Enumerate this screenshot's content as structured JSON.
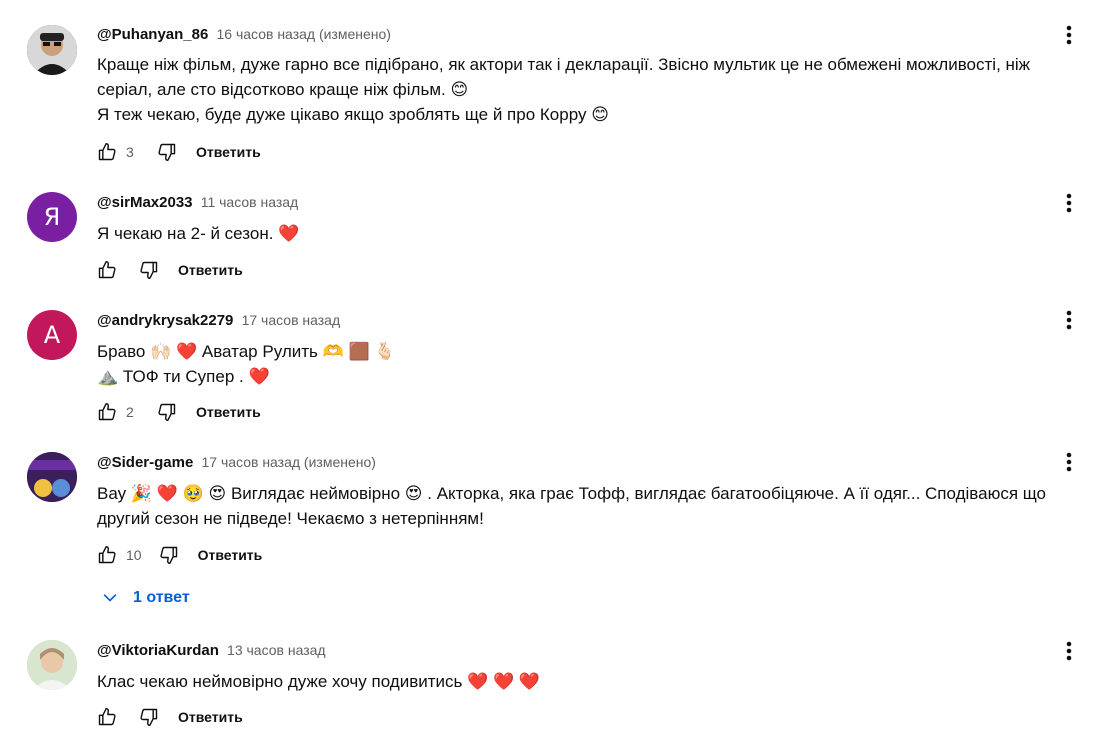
{
  "comments": [
    {
      "author": "@Puhanyan_86",
      "time": "16 часов назад (изменено)",
      "lines": [
        "Краще ніж фільм, дуже гарно все підібрано, як актори так і декларації. Звісно мультик це не обмежені можливості, ніж",
        "серіал, але сто відсотково краще ніж фільм. 😊",
        "Я теж чекаю, буде дуже цікаво якщо зроблять ще й про Корру 😊"
      ],
      "likes": "3",
      "reply_label": "Ответить",
      "avatar": {
        "type": "photo",
        "bg": "#2b2b2b"
      }
    },
    {
      "author": "@sirMax2033",
      "time": "11 часов назад",
      "lines": [
        "Я чекаю на 2- й сезон. ❤️"
      ],
      "likes": "",
      "reply_label": "Ответить",
      "avatar": {
        "type": "letter",
        "letter": "Я",
        "bg": "#7b1fa2"
      }
    },
    {
      "author": "@andrykrysak2279",
      "time": "17 часов назад",
      "lines": [
        "Браво 🙌🏻 ❤️ Аватар Рулить 🫶 🟫 🫰🏻",
        "⛰️ ТОФ ти Супер . ❤️"
      ],
      "likes": "2",
      "reply_label": "Ответить",
      "avatar": {
        "type": "letter",
        "letter": "A",
        "bg": "#c2185b"
      }
    },
    {
      "author": "@Sider-game",
      "time": "17 часов назад (изменено)",
      "lines": [
        "Вау 🎉 ❤️ 🥹 😍 Виглядає неймовірно 😍 . Акторка, яка грає Тофф, виглядає багатообіцяюче. А її одяг... Сподіваюся що",
        "другий сезон не підведе! Чекаємо з нетерпінням!"
      ],
      "likes": "10",
      "reply_label": "Ответить",
      "avatar": {
        "type": "photo",
        "bg": "#3a1f5c",
        "text": "IDER-GAME"
      }
    },
    {
      "author": "@ViktoriaKurdan",
      "time": "13 часов назад",
      "lines": [
        "Клас чекаю неймовірно дуже хочу подивитись ❤️ ❤️ ❤️"
      ],
      "likes": "",
      "reply_label": "Ответить",
      "avatar": {
        "type": "photo",
        "bg": "#c9b8a6"
      }
    }
  ],
  "replies_toggle": {
    "label": "1 ответ",
    "color": "#065fd4"
  },
  "colors": {
    "meta": "#606060",
    "text": "#0f0f0f",
    "link": "#065fd4"
  },
  "icons": [
    "like-icon",
    "dislike-icon",
    "more-vert-icon",
    "chevron-down-icon"
  ]
}
